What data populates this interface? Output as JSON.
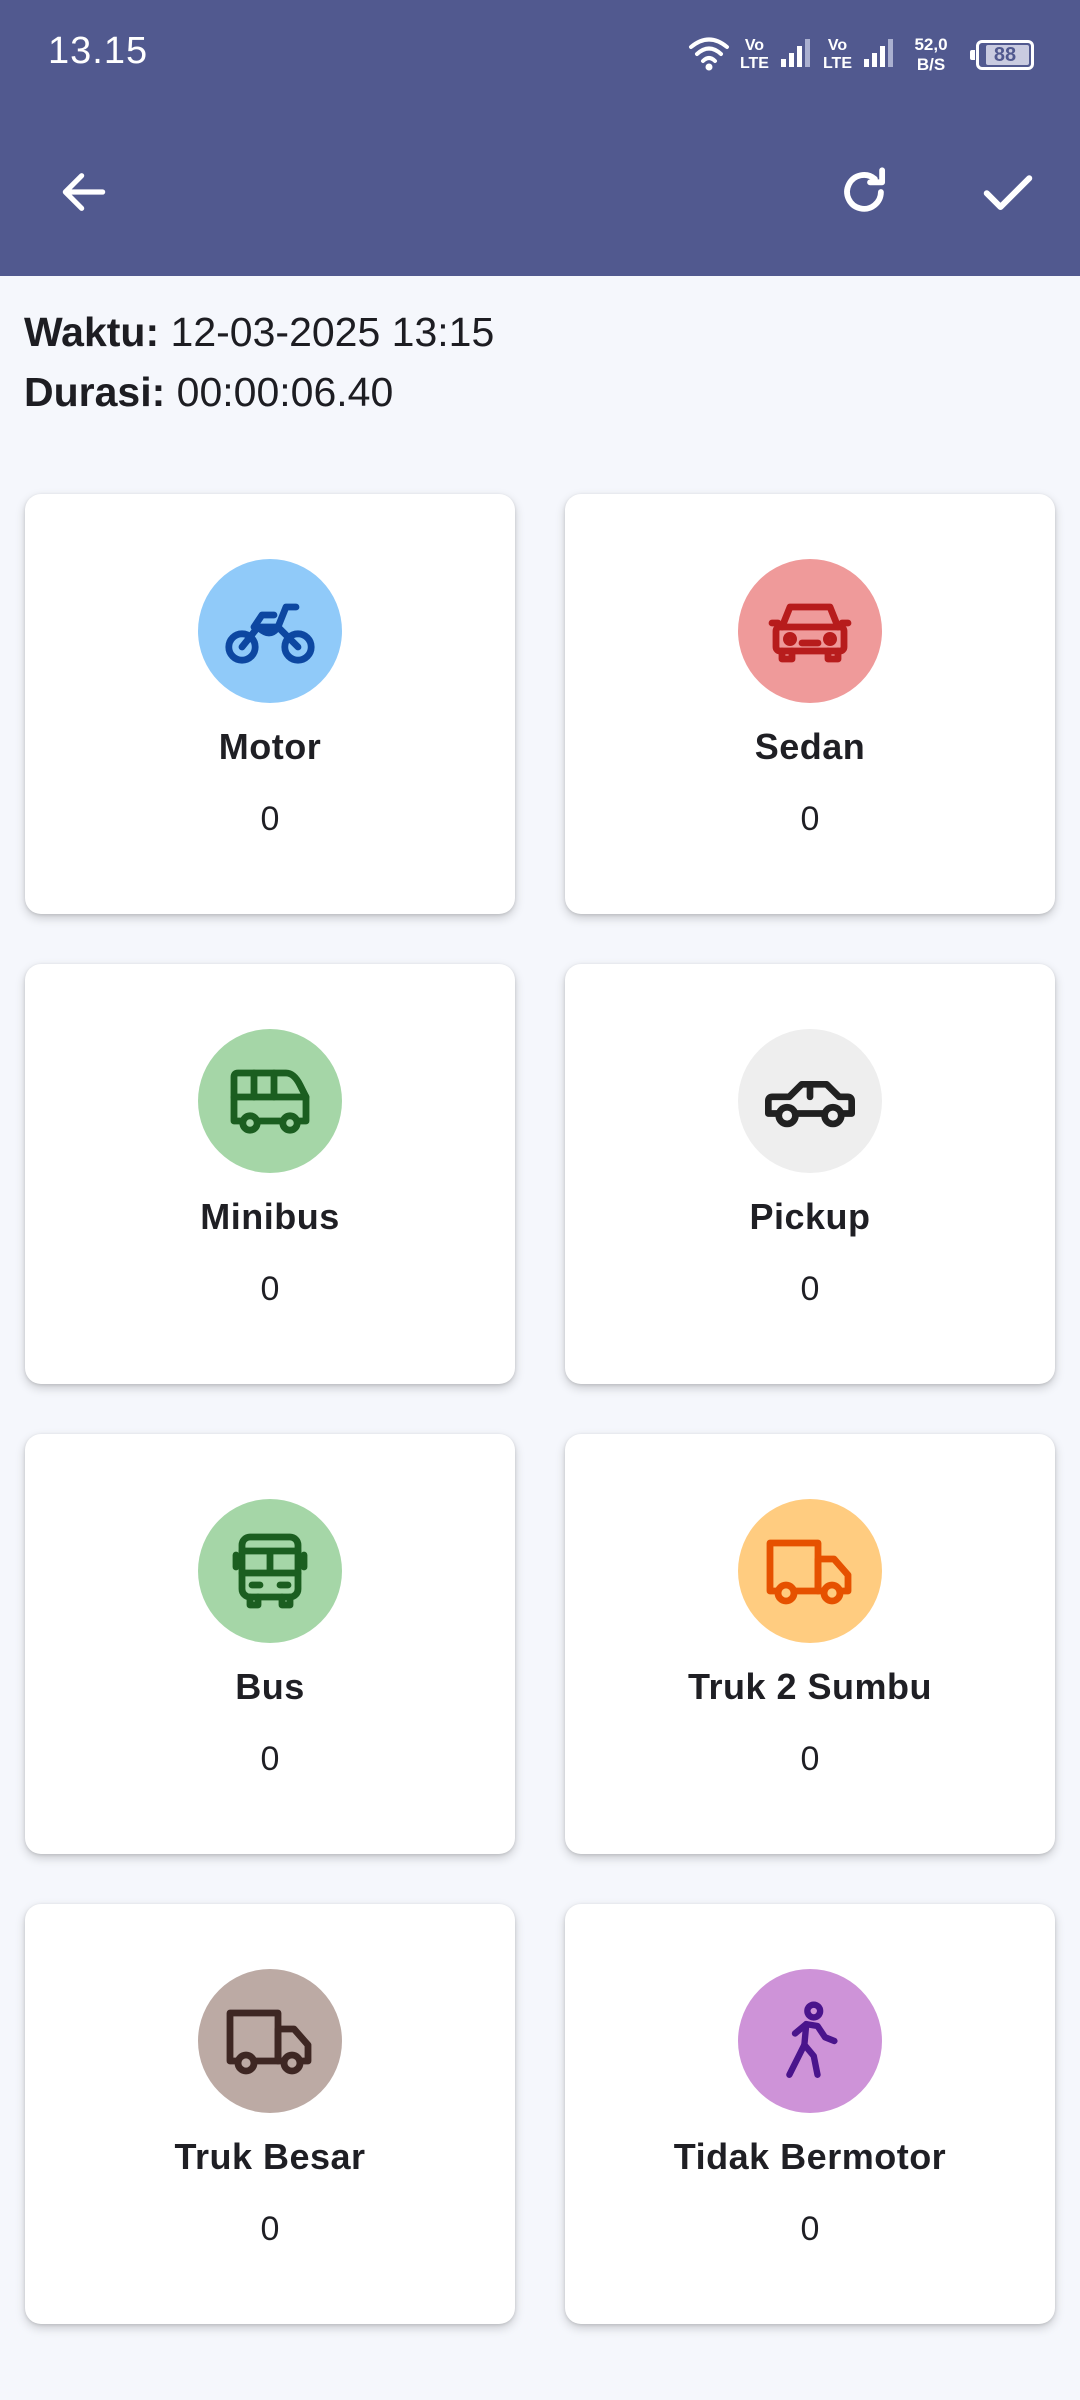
{
  "status_bar": {
    "time": "13.15",
    "volte1_top": "Vo",
    "volte1_bottom": "LTE",
    "volte2_top": "Vo",
    "volte2_bottom": "LTE",
    "net_speed_value": "52,0",
    "net_speed_unit": "B/S",
    "battery": "88"
  },
  "toolbar": {
    "back_icon": "arrow-left-icon",
    "refresh_icon": "refresh-icon",
    "confirm_icon": "check-icon",
    "color": "#51598f"
  },
  "info": {
    "time_label": "Waktu:",
    "time_value": "12-03-2025 13:15",
    "duration_label": "Durasi:",
    "duration_value": "00:00:06.40"
  },
  "vehicles": [
    {
      "label": "Motor",
      "count": "0",
      "icon": "motorcycle-icon",
      "bg": "#90caf9",
      "fg": "#0d47a1"
    },
    {
      "label": "Sedan",
      "count": "0",
      "icon": "sedan-car-icon",
      "bg": "#ef9a9a",
      "fg": "#b71c1c"
    },
    {
      "label": "Minibus",
      "count": "0",
      "icon": "minibus-icon",
      "bg": "#a5d6a7",
      "fg": "#1b5e20"
    },
    {
      "label": "Pickup",
      "count": "0",
      "icon": "pickup-car-icon",
      "bg": "#eeeeee",
      "fg": "#212121"
    },
    {
      "label": "Bus",
      "count": "0",
      "icon": "bus-icon",
      "bg": "#a5d6a7",
      "fg": "#1b5e20"
    },
    {
      "label": "Truk 2 Sumbu",
      "count": "0",
      "icon": "truck-icon",
      "bg": "#ffcc80",
      "fg": "#e65100"
    },
    {
      "label": "Truk Besar",
      "count": "0",
      "icon": "truck-icon",
      "bg": "#bcaaa4",
      "fg": "#3e2723"
    },
    {
      "label": "Tidak Bermotor",
      "count": "0",
      "icon": "pedestrian-icon",
      "bg": "#ce93d8",
      "fg": "#4a148c"
    }
  ]
}
